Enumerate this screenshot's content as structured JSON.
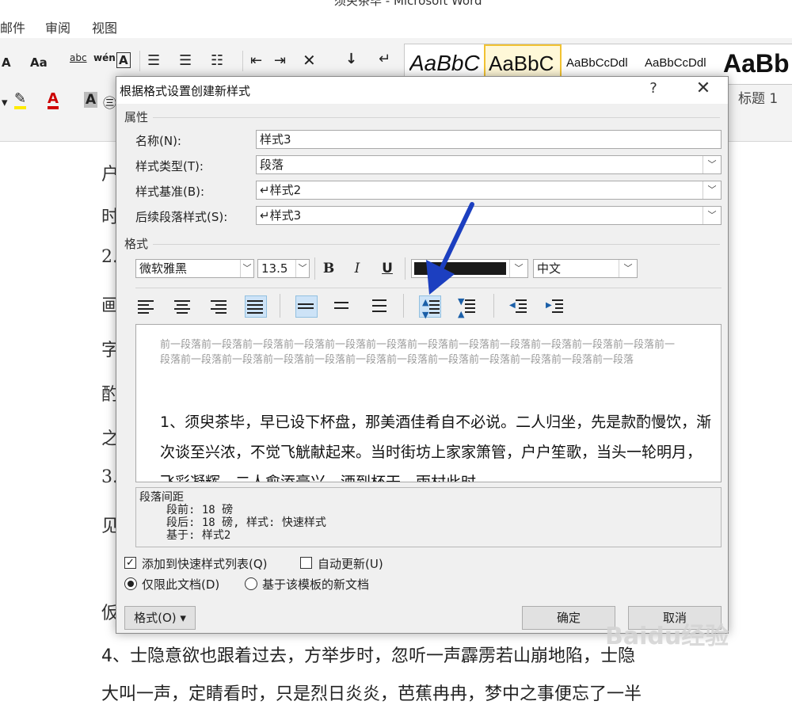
{
  "window": {
    "title": "须臾茶毕 - Microsoft Word"
  },
  "menu": [
    "邮件",
    "审阅",
    "视图"
  ],
  "ribbon": {
    "font_size_btn": "A",
    "change_case_btn": "Aa",
    "phonetic_btn": "abc",
    "char_border_btn": "A",
    "styles": [
      {
        "label": "AaBbC",
        "selected": false
      },
      {
        "label": "AaBbC",
        "selected": true
      },
      {
        "label": "AaBbCcDdl",
        "selected": false
      },
      {
        "label": "AaBbCcDdl",
        "selected": false
      },
      {
        "label": "AaBb",
        "selected": false
      }
    ],
    "heading1": "标题 1"
  },
  "document": {
    "left_chars": [
      "户",
      "时",
      "2.",
      "画",
      "字",
      "酌",
      "之",
      "3.",
      "见",
      "",
      "仮"
    ],
    "line4": "4、士隐意欲也跟着过去，方举步时，忽听一声霹雳若山崩地陷，士隐",
    "line5": "大叫一声，定睛看时，只是烈日炎炎，芭蕉冉冉，梦中之事便忘了一半"
  },
  "dialog": {
    "title": "根据格式设置创建新样式",
    "help": "?",
    "close": "✕",
    "properties_group": "属性",
    "name_label": "名称(N):",
    "name_value": "样式3",
    "type_label": "样式类型(T):",
    "type_value": "段落",
    "based_label": "样式基准(B):",
    "based_value": "↵样式2",
    "next_label": "后续段落样式(S):",
    "next_value": "↵样式3",
    "format_group": "格式",
    "font_value": "微软雅黑",
    "size_value": "13.5",
    "bold": "B",
    "italic": "I",
    "underline": "U",
    "color_value": "#1a1a1a",
    "lang_value": "中文",
    "preview_prev": "前一段落前一段落前一段落前一段落前一段落前一段落前一段落前一段落前一段落前一段落前一段落前一段落前一段落前一段落前一段落前一段落前一段落前一段落前一段落前一段落前一段落前一段落前一段落前一段落",
    "preview_text": "1、须臾茶毕，早已设下杯盘，那美酒佳肴自不必说。二人归坐，先是款酌慢饮，渐次谈至兴浓，不觉飞觥献起来。当时街坊上家家箫管，户户笙歌，当头一轮明月，飞彩凝辉，二人愈添豪兴，酒到杯干。雨村此时",
    "desc_title": "段落间距",
    "desc_lines": [
      "段前: 18 磅",
      "段后: 18 磅, 样式: 快速样式",
      "基于: 样式2"
    ],
    "add_quick": "添加到快速样式列表(Q)",
    "add_quick_checked": true,
    "auto_update": "自动更新(U)",
    "auto_update_checked": false,
    "only_doc": "仅限此文档(D)",
    "new_docs": "基于该模板的新文档",
    "format_btn": "格式(O) ▾",
    "ok_btn": "确定",
    "cancel_btn": "取消"
  },
  "watermark": "Baidu经验"
}
